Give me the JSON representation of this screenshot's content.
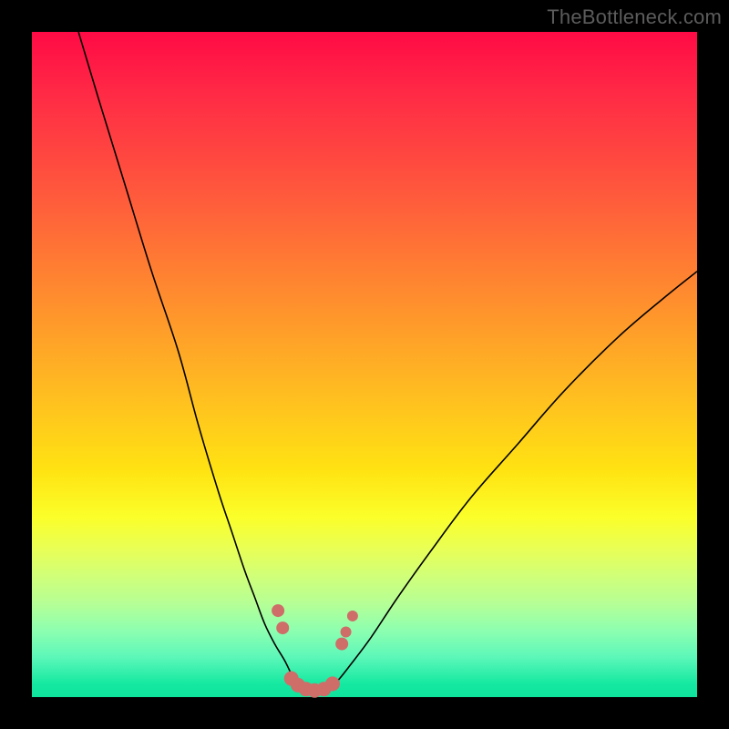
{
  "watermark": {
    "text": "TheBottleneck.com"
  },
  "colors": {
    "plot_border": "#000000",
    "curve": "#000000",
    "dot": "#cf6d69",
    "gradient_top": "#ff0a45",
    "gradient_bottom": "#0fe49c"
  },
  "chart_data": {
    "type": "line",
    "title": "",
    "xlabel": "",
    "ylabel": "",
    "xlim": [
      0,
      100
    ],
    "ylim": [
      0,
      100
    ],
    "grid": false,
    "legend": false,
    "annotations": [],
    "series": [
      {
        "name": "left-curve",
        "x": [
          7,
          10,
          14,
          18,
          22,
          25,
          28,
          30,
          32,
          33.5,
          35,
          36.5,
          38,
          39,
          40,
          40.8
        ],
        "y": [
          100,
          90,
          77,
          64,
          52,
          41,
          31,
          25,
          19,
          15,
          11,
          8,
          5.5,
          3.5,
          2,
          1.2
        ]
      },
      {
        "name": "right-curve",
        "x": [
          44.5,
          46,
          48,
          51,
          55,
          60,
          66,
          73,
          80,
          88,
          95,
          100
        ],
        "y": [
          1.2,
          2.5,
          5,
          9,
          15,
          22,
          30,
          38,
          46,
          54,
          60,
          64
        ]
      },
      {
        "name": "floor",
        "x": [
          40.8,
          41.5,
          42.5,
          43.5,
          44.5
        ],
        "y": [
          1.2,
          0.9,
          0.8,
          0.9,
          1.2
        ]
      }
    ],
    "points": [
      {
        "name": "dot-left-upper",
        "x": 37.0,
        "y": 13.0,
        "r": 7
      },
      {
        "name": "dot-left-lower",
        "x": 37.7,
        "y": 10.4,
        "r": 7
      },
      {
        "name": "dot-floor-1",
        "x": 39.0,
        "y": 2.8,
        "r": 8
      },
      {
        "name": "dot-floor-2",
        "x": 40.0,
        "y": 1.8,
        "r": 8
      },
      {
        "name": "dot-floor-3",
        "x": 41.2,
        "y": 1.2,
        "r": 8
      },
      {
        "name": "dot-floor-4",
        "x": 42.5,
        "y": 1.0,
        "r": 8
      },
      {
        "name": "dot-floor-5",
        "x": 43.9,
        "y": 1.2,
        "r": 8
      },
      {
        "name": "dot-floor-6",
        "x": 45.2,
        "y": 2.0,
        "r": 8
      },
      {
        "name": "dot-right-1",
        "x": 46.6,
        "y": 8.0,
        "r": 7
      },
      {
        "name": "dot-right-2",
        "x": 47.2,
        "y": 9.8,
        "r": 6
      },
      {
        "name": "dot-right-3",
        "x": 48.2,
        "y": 12.2,
        "r": 6
      }
    ]
  }
}
